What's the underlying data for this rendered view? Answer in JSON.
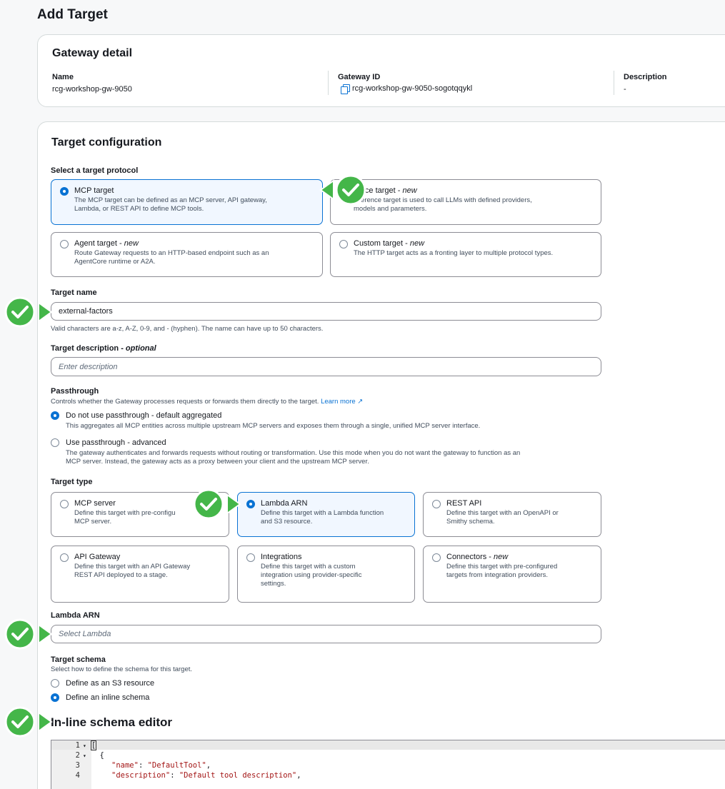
{
  "page": {
    "title": "Add Target"
  },
  "gateway_detail": {
    "heading": "Gateway detail",
    "name_label": "Name",
    "name_value": "rcg-workshop-gw-9050",
    "id_label": "Gateway ID",
    "id_value": "rcg-workshop-gw-9050-sogotqqykl",
    "desc_label": "Description",
    "desc_value": "-"
  },
  "target_config": {
    "heading": "Target configuration",
    "protocol_label": "Select a target protocol",
    "protocols": [
      {
        "title": "MCP target",
        "desc_1": "The MCP target can be defined as an MCP server, API gateway,",
        "desc_2": "Lambda, or REST API to define MCP tools.",
        "selected": true
      },
      {
        "title": "rence target - ",
        "new": "new",
        "desc_1": "inference target is used to call LLMs with defined providers,",
        "desc_2": "models and parameters.",
        "selected": false
      },
      {
        "title": "Agent target - ",
        "new": "new",
        "desc_1": "Route Gateway requests to an HTTP-based endpoint such as an",
        "desc_2": "AgentCore runtime or A2A.",
        "selected": false
      },
      {
        "title": "Custom target - ",
        "new": "new",
        "desc_1": "The HTTP target acts as a fronting layer to multiple protocol types.",
        "desc_2": "",
        "selected": false
      }
    ],
    "target_name_label": "Target name",
    "target_name_value": "external-factors",
    "target_name_hint": "Valid characters are a-z, A-Z, 0-9, and - (hyphen). The name can have up to 50 characters.",
    "target_desc_label": "Target description - ",
    "target_desc_optional": "optional",
    "target_desc_placeholder": "Enter description",
    "passthrough": {
      "label": "Passthrough",
      "hint": "Controls whether the Gateway processes requests or forwards them directly to the target. ",
      "learn_more": "Learn more",
      "options": [
        {
          "title": "Do not use passthrough - default aggregated",
          "desc_1": "This aggregates all MCP entities across multiple upstream MCP servers and exposes them through a single, unified MCP server interface.",
          "desc_2": "",
          "selected": true
        },
        {
          "title": "Use passthrough - advanced",
          "desc_1": "The gateway authenticates and forwards requests without routing or transformation. Use this mode when you do not want the gateway to function as an",
          "desc_2": "MCP server. Instead, the gateway acts as a proxy between your client and the upstream MCP server.",
          "selected": false
        }
      ]
    },
    "target_type_label": "Target type",
    "target_types": [
      {
        "title": "MCP server",
        "new": "",
        "desc_1": "Define this target with pre-configu",
        "desc_2": "MCP server.",
        "desc_3": "",
        "selected": false
      },
      {
        "title": "Lambda ARN",
        "new": "",
        "desc_1": "Define this target with a Lambda function",
        "desc_2": "and S3 resource.",
        "desc_3": "",
        "selected": true
      },
      {
        "title": "REST API",
        "new": "",
        "desc_1": "Define this target with an OpenAPI or",
        "desc_2": "Smithy schema.",
        "desc_3": "",
        "selected": false
      },
      {
        "title": "API Gateway",
        "new": "",
        "desc_1": "Define this target with an API Gateway",
        "desc_2": "REST API deployed to a stage.",
        "desc_3": "",
        "selected": false
      },
      {
        "title": "Integrations",
        "new": "",
        "desc_1": "Define this target with a custom",
        "desc_2": "integration using provider-specific",
        "desc_3": "settings.",
        "selected": false
      },
      {
        "title": "Connectors - ",
        "new": "new",
        "desc_1": "Define this target with pre-configured",
        "desc_2": "targets from integration providers.",
        "desc_3": "",
        "selected": false
      }
    ],
    "lambda_arn_label": "Lambda ARN",
    "lambda_arn_placeholder": "Select Lambda",
    "schema": {
      "label": "Target schema",
      "hint": "Select how to define the schema for this target.",
      "options": [
        {
          "title": "Define as an S3 resource",
          "selected": false
        },
        {
          "title": "Define an inline schema",
          "selected": true
        }
      ]
    },
    "editor": {
      "heading": "In-line schema editor",
      "lines": [
        {
          "num": "1",
          "fold": "▾",
          "code": "["
        },
        {
          "num": "2",
          "fold": "▾",
          "code": "  {"
        },
        {
          "num": "3",
          "fold": "",
          "key": "\"name\"",
          "sep": ": ",
          "val": "\"DefaultTool\"",
          "end": ","
        },
        {
          "num": "4",
          "fold": "",
          "key": "\"description\"",
          "sep": ": ",
          "val": "\"Default tool description\"",
          "end": ","
        }
      ]
    }
  },
  "colors": {
    "accent": "#0972d3",
    "check_green": "#44b649",
    "check_border": "#ffffff"
  }
}
